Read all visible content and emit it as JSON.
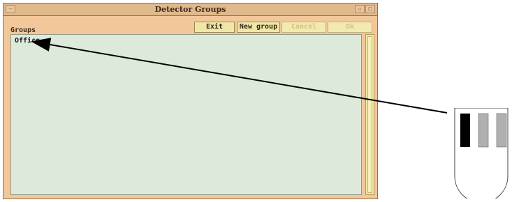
{
  "window": {
    "title": "Detector Groups"
  },
  "groups_label": "Groups",
  "buttons": {
    "exit": "Exit",
    "new_group": "New group",
    "cancel": "Cancel",
    "ok": "Ok"
  },
  "groups": [
    {
      "label": "Office"
    }
  ],
  "colors": {
    "window_bg": "#f2c79a",
    "list_bg": "#ddeadb",
    "button_bg": "#f0e7a7",
    "disabled_text": "#d2c27c"
  }
}
